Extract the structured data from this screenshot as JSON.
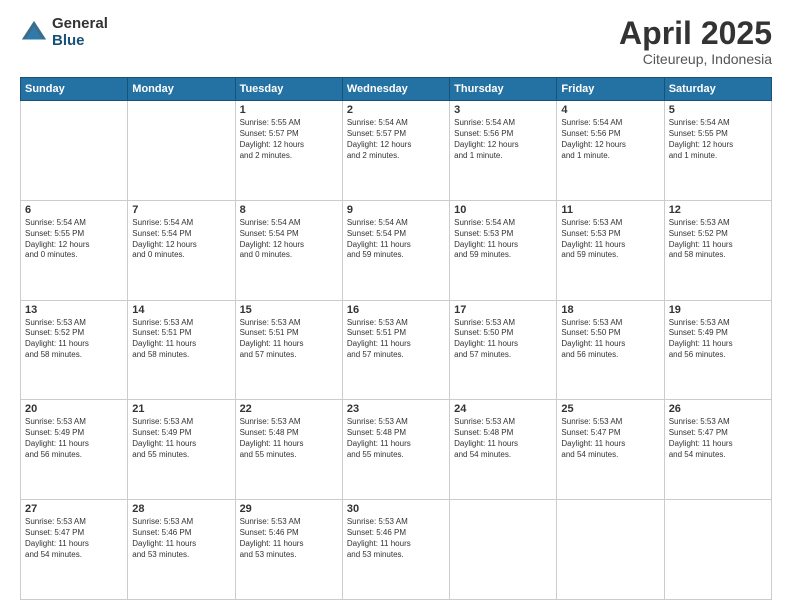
{
  "logo": {
    "general": "General",
    "blue": "Blue"
  },
  "header": {
    "month": "April 2025",
    "location": "Citeureup, Indonesia"
  },
  "weekdays": [
    "Sunday",
    "Monday",
    "Tuesday",
    "Wednesday",
    "Thursday",
    "Friday",
    "Saturday"
  ],
  "weeks": [
    [
      {
        "day": "",
        "content": ""
      },
      {
        "day": "",
        "content": ""
      },
      {
        "day": "1",
        "content": "Sunrise: 5:55 AM\nSunset: 5:57 PM\nDaylight: 12 hours\nand 2 minutes."
      },
      {
        "day": "2",
        "content": "Sunrise: 5:54 AM\nSunset: 5:57 PM\nDaylight: 12 hours\nand 2 minutes."
      },
      {
        "day": "3",
        "content": "Sunrise: 5:54 AM\nSunset: 5:56 PM\nDaylight: 12 hours\nand 1 minute."
      },
      {
        "day": "4",
        "content": "Sunrise: 5:54 AM\nSunset: 5:56 PM\nDaylight: 12 hours\nand 1 minute."
      },
      {
        "day": "5",
        "content": "Sunrise: 5:54 AM\nSunset: 5:55 PM\nDaylight: 12 hours\nand 1 minute."
      }
    ],
    [
      {
        "day": "6",
        "content": "Sunrise: 5:54 AM\nSunset: 5:55 PM\nDaylight: 12 hours\nand 0 minutes."
      },
      {
        "day": "7",
        "content": "Sunrise: 5:54 AM\nSunset: 5:54 PM\nDaylight: 12 hours\nand 0 minutes."
      },
      {
        "day": "8",
        "content": "Sunrise: 5:54 AM\nSunset: 5:54 PM\nDaylight: 12 hours\nand 0 minutes."
      },
      {
        "day": "9",
        "content": "Sunrise: 5:54 AM\nSunset: 5:54 PM\nDaylight: 11 hours\nand 59 minutes."
      },
      {
        "day": "10",
        "content": "Sunrise: 5:54 AM\nSunset: 5:53 PM\nDaylight: 11 hours\nand 59 minutes."
      },
      {
        "day": "11",
        "content": "Sunrise: 5:53 AM\nSunset: 5:53 PM\nDaylight: 11 hours\nand 59 minutes."
      },
      {
        "day": "12",
        "content": "Sunrise: 5:53 AM\nSunset: 5:52 PM\nDaylight: 11 hours\nand 58 minutes."
      }
    ],
    [
      {
        "day": "13",
        "content": "Sunrise: 5:53 AM\nSunset: 5:52 PM\nDaylight: 11 hours\nand 58 minutes."
      },
      {
        "day": "14",
        "content": "Sunrise: 5:53 AM\nSunset: 5:51 PM\nDaylight: 11 hours\nand 58 minutes."
      },
      {
        "day": "15",
        "content": "Sunrise: 5:53 AM\nSunset: 5:51 PM\nDaylight: 11 hours\nand 57 minutes."
      },
      {
        "day": "16",
        "content": "Sunrise: 5:53 AM\nSunset: 5:51 PM\nDaylight: 11 hours\nand 57 minutes."
      },
      {
        "day": "17",
        "content": "Sunrise: 5:53 AM\nSunset: 5:50 PM\nDaylight: 11 hours\nand 57 minutes."
      },
      {
        "day": "18",
        "content": "Sunrise: 5:53 AM\nSunset: 5:50 PM\nDaylight: 11 hours\nand 56 minutes."
      },
      {
        "day": "19",
        "content": "Sunrise: 5:53 AM\nSunset: 5:49 PM\nDaylight: 11 hours\nand 56 minutes."
      }
    ],
    [
      {
        "day": "20",
        "content": "Sunrise: 5:53 AM\nSunset: 5:49 PM\nDaylight: 11 hours\nand 56 minutes."
      },
      {
        "day": "21",
        "content": "Sunrise: 5:53 AM\nSunset: 5:49 PM\nDaylight: 11 hours\nand 55 minutes."
      },
      {
        "day": "22",
        "content": "Sunrise: 5:53 AM\nSunset: 5:48 PM\nDaylight: 11 hours\nand 55 minutes."
      },
      {
        "day": "23",
        "content": "Sunrise: 5:53 AM\nSunset: 5:48 PM\nDaylight: 11 hours\nand 55 minutes."
      },
      {
        "day": "24",
        "content": "Sunrise: 5:53 AM\nSunset: 5:48 PM\nDaylight: 11 hours\nand 54 minutes."
      },
      {
        "day": "25",
        "content": "Sunrise: 5:53 AM\nSunset: 5:47 PM\nDaylight: 11 hours\nand 54 minutes."
      },
      {
        "day": "26",
        "content": "Sunrise: 5:53 AM\nSunset: 5:47 PM\nDaylight: 11 hours\nand 54 minutes."
      }
    ],
    [
      {
        "day": "27",
        "content": "Sunrise: 5:53 AM\nSunset: 5:47 PM\nDaylight: 11 hours\nand 54 minutes."
      },
      {
        "day": "28",
        "content": "Sunrise: 5:53 AM\nSunset: 5:46 PM\nDaylight: 11 hours\nand 53 minutes."
      },
      {
        "day": "29",
        "content": "Sunrise: 5:53 AM\nSunset: 5:46 PM\nDaylight: 11 hours\nand 53 minutes."
      },
      {
        "day": "30",
        "content": "Sunrise: 5:53 AM\nSunset: 5:46 PM\nDaylight: 11 hours\nand 53 minutes."
      },
      {
        "day": "",
        "content": ""
      },
      {
        "day": "",
        "content": ""
      },
      {
        "day": "",
        "content": ""
      }
    ]
  ]
}
